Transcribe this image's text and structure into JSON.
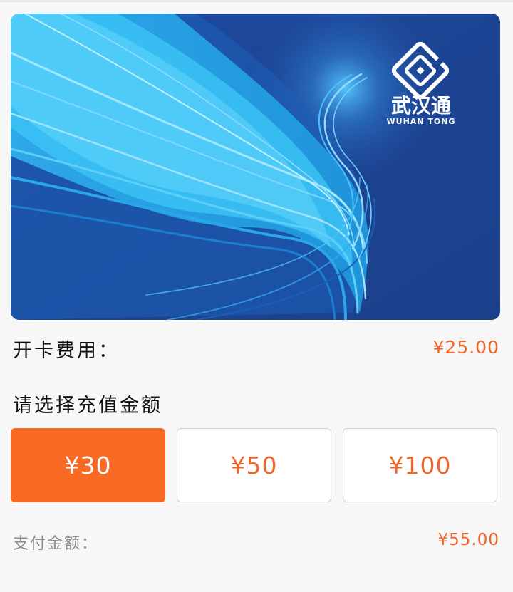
{
  "card": {
    "brand_cn": "武汉通",
    "brand_en": "WUHAN TONG",
    "colors": {
      "base": "#1f4495",
      "light": "#33b6ee",
      "pale": "#8fdcff"
    },
    "logo_icon": "wuhantong-logo-icon"
  },
  "fee": {
    "label": "开卡费用：",
    "value": "¥25.00"
  },
  "recharge": {
    "title": "请选择充值金额",
    "options": [
      {
        "label": "¥30",
        "selected": true
      },
      {
        "label": "¥50",
        "selected": false
      },
      {
        "label": "¥100",
        "selected": false
      }
    ]
  },
  "payment": {
    "label": "支付金额：",
    "value": "¥55.00"
  },
  "colors": {
    "accent": "#f96a24",
    "accent_text": "#f0652a",
    "background": "#f7f7f7"
  }
}
